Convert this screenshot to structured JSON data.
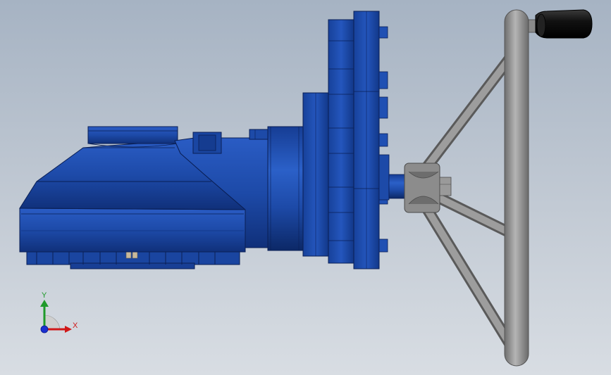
{
  "viewport": {
    "background_top": "#a6b3c3",
    "background_bottom": "#d8dde3"
  },
  "model": {
    "body_color": "#1d4aa8",
    "body_shadow": "#0d2c72",
    "body_edge": "#0a1f55",
    "handwheel_color": "#8a8a8a",
    "handle_grip_color": "#1a1a1a"
  },
  "triad": {
    "x_label": "X",
    "y_label": "Y",
    "x_color": "#d01818",
    "y_color": "#1f9a2a",
    "z_color": "#1a2fd0"
  }
}
